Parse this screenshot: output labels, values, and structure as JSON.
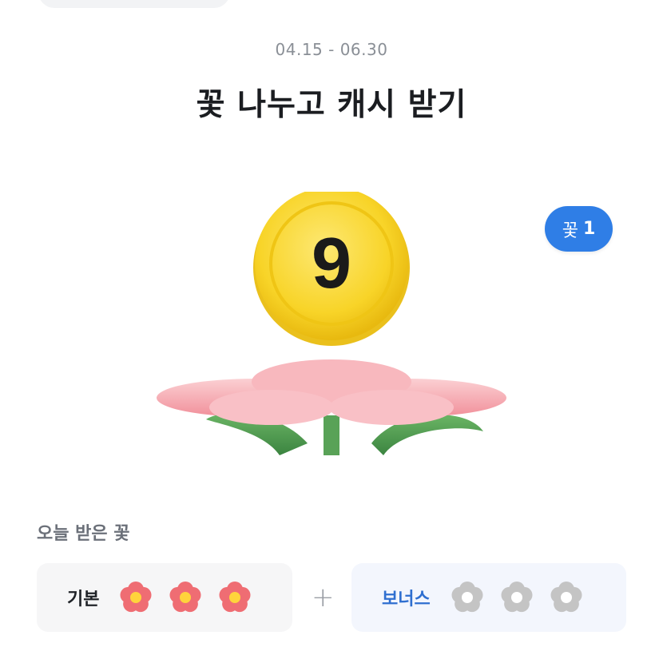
{
  "header": {
    "period": "04.15 - 06.30",
    "title": "꽃 나누고 캐시 받기"
  },
  "coin": {
    "value": "9"
  },
  "flower_badge": {
    "label": "꽃",
    "count": "1"
  },
  "today": {
    "section_label": "오늘 받은 꽃",
    "basic": {
      "title": "기본",
      "collected": 3,
      "total": 3
    },
    "plus": "+",
    "bonus": {
      "title": "보너스",
      "collected": 0,
      "total": 3
    }
  },
  "colors": {
    "coin": "#f8d428",
    "badge": "#2f7ee6",
    "petal": "#f4a3ab",
    "leaf": "#4f9a4c",
    "flower_active": "#ef6d73",
    "flower_center": "#ffd43b",
    "flower_inactive": "#c4c4c4"
  }
}
